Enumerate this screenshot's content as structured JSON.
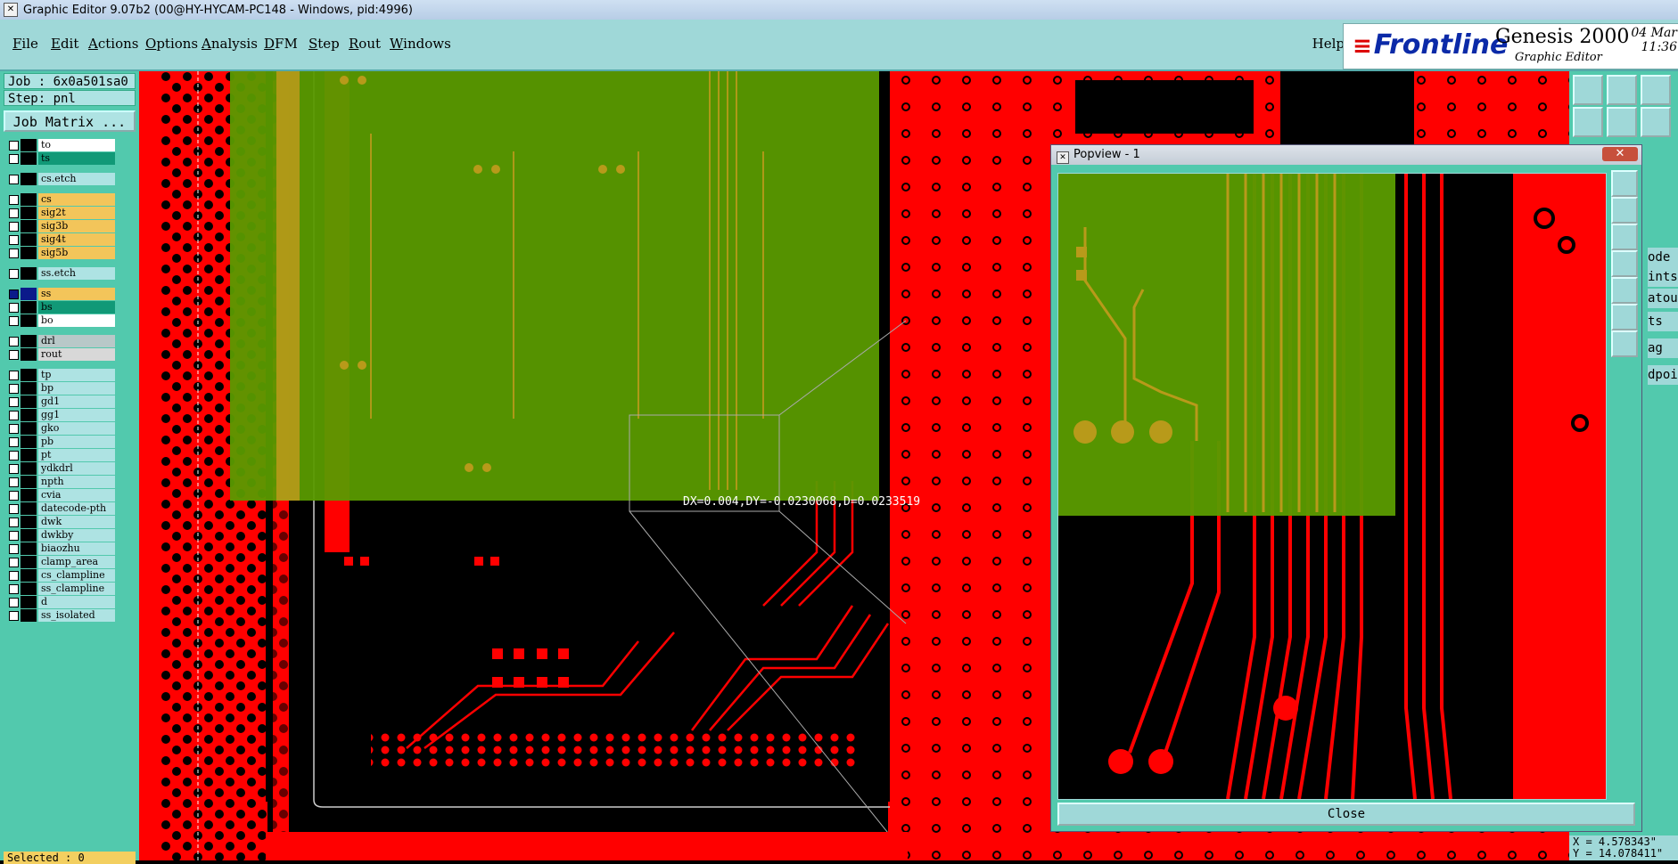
{
  "window": {
    "title": "Graphic Editor 9.07b2 (00@HY-HYCAM-PC148 - Windows, pid:4996)"
  },
  "menu": {
    "items": [
      "File",
      "Edit",
      "Actions",
      "Options",
      "Analysis",
      "DFM",
      "Step",
      "Rout",
      "Windows"
    ],
    "help": "Help"
  },
  "brand": {
    "logo": "Frontline",
    "product": "Genesis 2000",
    "subtitle": "Graphic Editor",
    "date": "04 Mar",
    "time": "11:36"
  },
  "job": {
    "job_label": "Job : 6x0a501sa0",
    "step_label": "Step: pnl",
    "matrix_button": "Job Matrix ..."
  },
  "layers": [
    {
      "name": "to",
      "color": "#ffffff",
      "checked": false
    },
    {
      "name": "ts",
      "color": "#119977",
      "checked": false
    },
    {
      "name": "cs.etch",
      "color": "#aee3e3",
      "checked": false
    },
    {
      "name": "cs",
      "color": "#f3c55a",
      "checked": false
    },
    {
      "name": "sig2t",
      "color": "#f3c55a",
      "checked": false
    },
    {
      "name": "sig3b",
      "color": "#f3c55a",
      "checked": false
    },
    {
      "name": "sig4t",
      "color": "#f3c55a",
      "checked": false
    },
    {
      "name": "sig5b",
      "color": "#f3c55a",
      "checked": false
    },
    {
      "name": "ss.etch",
      "color": "#aee3e3",
      "checked": false
    },
    {
      "name": "ss",
      "color": "#f3c55a",
      "checked": true
    },
    {
      "name": "bs",
      "color": "#119977",
      "checked": false
    },
    {
      "name": "bo",
      "color": "#ffffff",
      "checked": false
    },
    {
      "name": "drl",
      "color": "#b8c8c8",
      "checked": false
    },
    {
      "name": "rout",
      "color": "#d8d8d8",
      "checked": false
    },
    {
      "name": "tp",
      "color": "#aee3e3",
      "checked": false
    },
    {
      "name": "bp",
      "color": "#aee3e3",
      "checked": false
    },
    {
      "name": "gd1",
      "color": "#aee3e3",
      "checked": false
    },
    {
      "name": "gg1",
      "color": "#aee3e3",
      "checked": false
    },
    {
      "name": "gko",
      "color": "#aee3e3",
      "checked": false
    },
    {
      "name": "pb",
      "color": "#aee3e3",
      "checked": false
    },
    {
      "name": "pt",
      "color": "#aee3e3",
      "checked": false
    },
    {
      "name": "ydkdrl",
      "color": "#aee3e3",
      "checked": false
    },
    {
      "name": "npth",
      "color": "#aee3e3",
      "checked": false
    },
    {
      "name": "cvia",
      "color": "#aee3e3",
      "checked": false
    },
    {
      "name": "datecode-pth",
      "color": "#aee3e3",
      "checked": false
    },
    {
      "name": "dwk",
      "color": "#aee3e3",
      "checked": false
    },
    {
      "name": "dwkby",
      "color": "#aee3e3",
      "checked": false
    },
    {
      "name": "biaozhu",
      "color": "#aee3e3",
      "checked": false
    },
    {
      "name": "clamp_area",
      "color": "#aee3e3",
      "checked": false
    },
    {
      "name": "cs_clampline",
      "color": "#aee3e3",
      "checked": false
    },
    {
      "name": "ss_clampline",
      "color": "#aee3e3",
      "checked": false
    },
    {
      "name": "d",
      "color": "#aee3e3",
      "checked": false
    },
    {
      "name": "ss_isolated",
      "color": "#aee3e3",
      "checked": false
    }
  ],
  "canvas": {
    "measurement": "DX=0.004,DY=-0.0230068,D=0.0233519"
  },
  "selected": "Selected : 0",
  "right_labels": [
    "ode",
    "ints",
    "atour",
    "ts",
    "ag",
    "dpoi"
  ],
  "coords": {
    "x": "X = 4.578343\"",
    "y": "Y = 14.078411\""
  },
  "popview": {
    "title": "Popview - 1",
    "close_label": "Close"
  },
  "colors": {
    "copper": "#ff0000",
    "board": "#000000",
    "highlight": "#5a9a00",
    "panel": "#52c9ad",
    "button": "#9fd8d8"
  }
}
